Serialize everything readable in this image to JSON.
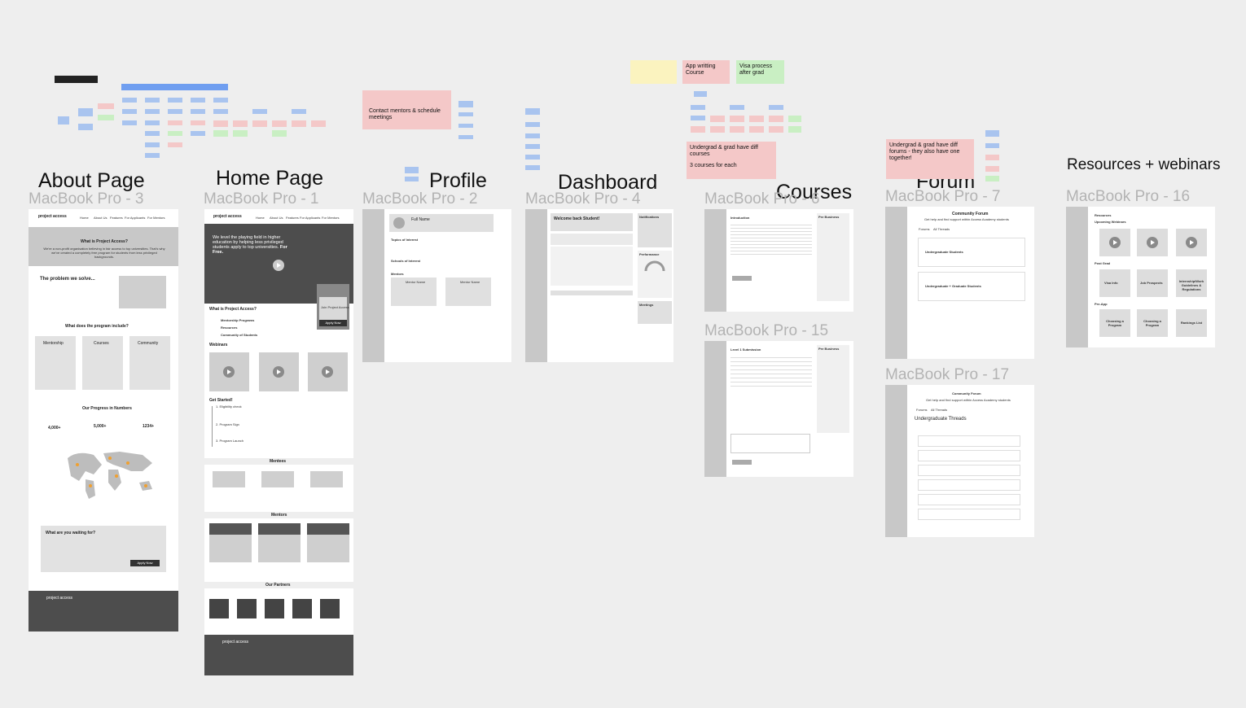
{
  "sections": {
    "about": "About Page",
    "home": "Home Page",
    "profile": "Profile",
    "dashboard": "Dashboard",
    "courses": "Courses",
    "forum": "Forum",
    "resources": "Resources + webinars"
  },
  "frame_labels": {
    "about": "MacBook Pro - 3",
    "home": "MacBook Pro - 1",
    "profile": "MacBook Pro - 2",
    "dashboard": "MacBook Pro - 4",
    "courses": "MacBook Pro - 6",
    "courses2": "MacBook Pro - 15",
    "forum": "MacBook Pro - 7",
    "forum2": "MacBook Pro - 17",
    "resources": "MacBook Pro - 16"
  },
  "stickies": {
    "contact": "Contact mentors & schedule meetings",
    "app_writing": "App writting Course",
    "visa": "Visa process after grad",
    "undergrad_courses": "Undergrad & grad have diff courses",
    "three_courses": "3 courses for each",
    "undergrad_forums": "Undergrad & grad have diff forums - they also have one together!"
  },
  "about": {
    "logo": "project access",
    "nav": [
      "Home",
      "About Us",
      "Features",
      "For Applicants",
      "For Mentors"
    ],
    "hero_title": "What is Project Access?",
    "hero_text": "We're a non-profit organisation believing in fair access to top universities. That's why we've created a completely free program for students from less privileged backgrounds.",
    "problem_title": "The problem we solve...",
    "program_title": "What does the program include?",
    "cards": [
      "Mentorship",
      "Courses",
      "Community"
    ],
    "progress_title": "Our Progress in Numbers",
    "stats": [
      "4,000+",
      "5,000+",
      "1234+"
    ],
    "cta_title": "What are you waiting for?",
    "cta_button": "Apply Now",
    "footer_logo": "project access"
  },
  "home": {
    "logo": "project access",
    "nav": [
      "Home",
      "About Us",
      "Features",
      "For Applicants",
      "For Mentors"
    ],
    "hero_text": "We level the playing field in higher education by helping less privileged students apply to top universities.",
    "hero_bold": "For Free.",
    "what_title": "What is Project Access?",
    "list": [
      "Mentorship Programs",
      "Resources",
      "Community of Students"
    ],
    "join_text": "Join Project Access",
    "apply_btn": "Apply Now",
    "webinars": "Webinars",
    "started": "Get Started!",
    "steps": [
      "1. Eligibility check",
      "2. Program Sign",
      "3. Program Launch"
    ],
    "mentees": "Mentees",
    "mentors": "Mentors",
    "partners": "Our Partners",
    "footer_logo": "project access"
  },
  "profile": {
    "full_name": "Full Name",
    "topics": "Topics of Interest",
    "schools": "Schools of Interest",
    "mentors": "Mentors",
    "mentor_name": "Mentor Name"
  },
  "dashboard": {
    "welcome": "Welcome back Student!",
    "notifications": "Notifications",
    "performance": "Performance",
    "meetings": "Meetings"
  },
  "courses": {
    "intro": "Introduction",
    "pre": "Pre Business",
    "lesson": "Level 1 Submission"
  },
  "forum": {
    "title": "Community Forum",
    "subtitle": "Get help and find support within Access Academy students",
    "tabs": [
      "Forums",
      "All Threads"
    ],
    "items": [
      "Undergraduate Students",
      "Undergraduate + Graduate Students"
    ],
    "threads_title": "Undergraduate Threads"
  },
  "resources": {
    "title": "Resources",
    "upcoming": "Upcoming Webinars",
    "post": "Post Grad",
    "tiles": [
      "Visa Info",
      "Job Prospects",
      "Internship/Work Guidelines & Regulations"
    ],
    "preapp": "Pre-App",
    "tiles2": [
      "Choosing a Program",
      "Choosing a Program",
      "Rankings List"
    ]
  }
}
